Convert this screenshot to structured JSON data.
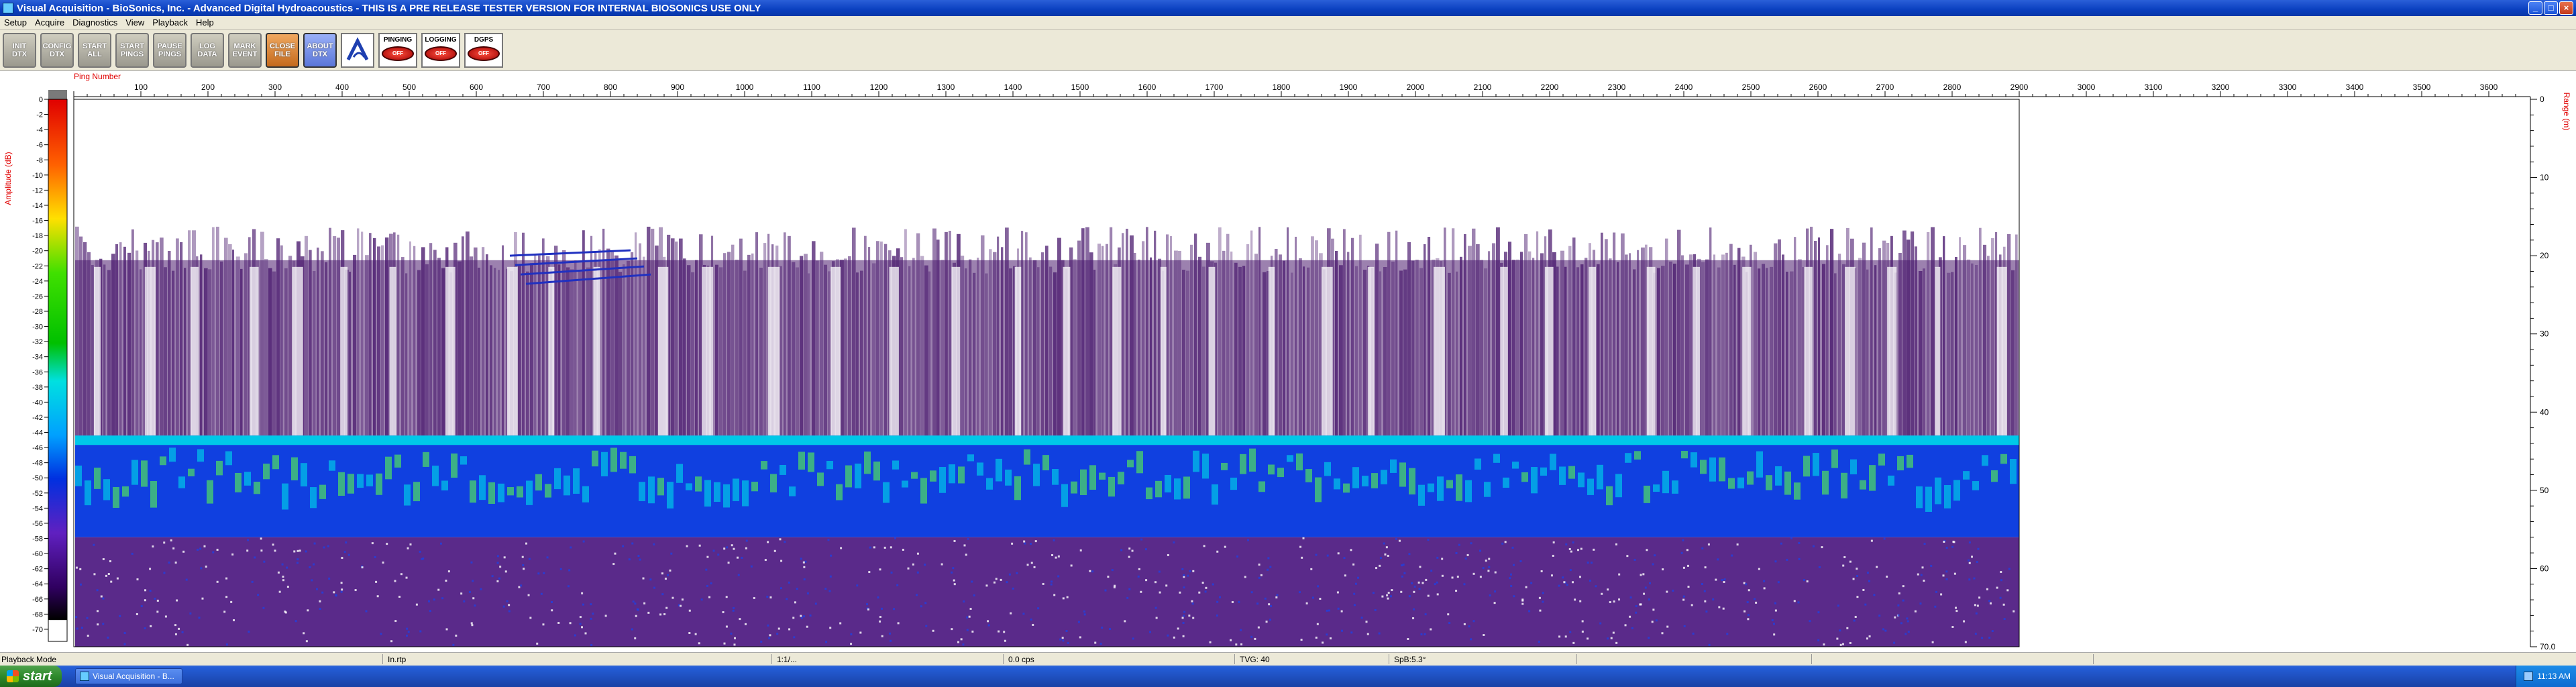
{
  "window": {
    "title": "Visual Acquisition  -  BioSonics, Inc.  -  Advanced Digital Hydroacoustics  -  THIS IS A PRE RELEASE TESTER VERSION FOR INTERNAL BIOSONICS USE ONLY",
    "controls": [
      "_",
      "□",
      "×"
    ]
  },
  "menu": [
    "Setup",
    "Acquire",
    "Diagnostics",
    "View",
    "Playback",
    "Help"
  ],
  "toolbar": {
    "buttons": [
      {
        "line1": "INIT",
        "line2": "DTX",
        "style": "gray"
      },
      {
        "line1": "CONFIG",
        "line2": "DTX",
        "style": "gray"
      },
      {
        "line1": "START",
        "line2": "ALL",
        "style": "gray"
      },
      {
        "line1": "START",
        "line2": "PINGS",
        "style": "gray"
      },
      {
        "line1": "PAUSE",
        "line2": "PINGS",
        "style": "gray"
      },
      {
        "line1": "LOG",
        "line2": "DATA",
        "style": "gray"
      },
      {
        "line1": "MARK",
        "line2": "EVENT",
        "style": "gray"
      },
      {
        "line1": "CLOSE",
        "line2": "FILE",
        "style": "orange"
      },
      {
        "line1": "ABOUT",
        "line2": "DTX",
        "style": "blue"
      }
    ],
    "status": [
      {
        "label": "PINGING",
        "led": "OFF"
      },
      {
        "label": "LOGGING",
        "led": "OFF"
      },
      {
        "label": "DGPS",
        "led": "OFF"
      }
    ]
  },
  "echogram": {
    "x_axis_label": "Ping Number",
    "x_ticks": [
      "100",
      "200",
      "300",
      "400",
      "500",
      "600",
      "700",
      "800",
      "900",
      "1000",
      "1100",
      "1200",
      "1300",
      "1400",
      "1500",
      "1600",
      "1700",
      "1800",
      "1900",
      "2000",
      "2100",
      "2200",
      "2300",
      "2400",
      "2500",
      "2600",
      "2700",
      "2800",
      "2900",
      "3000",
      "3100",
      "3200",
      "3300",
      "3400",
      "3500",
      "3600"
    ],
    "colorbar_label": "Amplitude (dB)",
    "colorbar_ticks": [
      "0",
      "-2",
      "-4",
      "-6",
      "-8",
      "-10",
      "-12",
      "-14",
      "-16",
      "-18",
      "-20",
      "-22",
      "-24",
      "-26",
      "-28",
      "-30",
      "-32",
      "-34",
      "-36",
      "-38",
      "-40",
      "-42",
      "-44",
      "-46",
      "-48",
      "-50",
      "-52",
      "-54",
      "-56",
      "-58",
      "-60",
      "-62",
      "-64",
      "-66",
      "-68",
      "-70"
    ],
    "range_label": "Range (m)",
    "range_ticks": [
      "0",
      "10",
      "20",
      "30",
      "40",
      "50",
      "60",
      "70.0"
    ],
    "colors": {
      "plankton": "#4a1a6e",
      "bottom_cyan": "#00c8e8",
      "bottom_blue": "#1040e0",
      "bottom_green": "#50e060",
      "sub_bottom": "#5a2a8a",
      "axis_label": "#e00000"
    }
  },
  "statusbar": {
    "mode": "Playback Mode",
    "f1": "In.rtp",
    "f2": "1:1/...",
    "f3": "0.0 cps",
    "f4": "TVG: 40",
    "f5": "SpB:5.3°"
  },
  "taskbar": {
    "start": "start",
    "task": "Visual Acquisition - B...",
    "clock": "11:13 AM"
  }
}
